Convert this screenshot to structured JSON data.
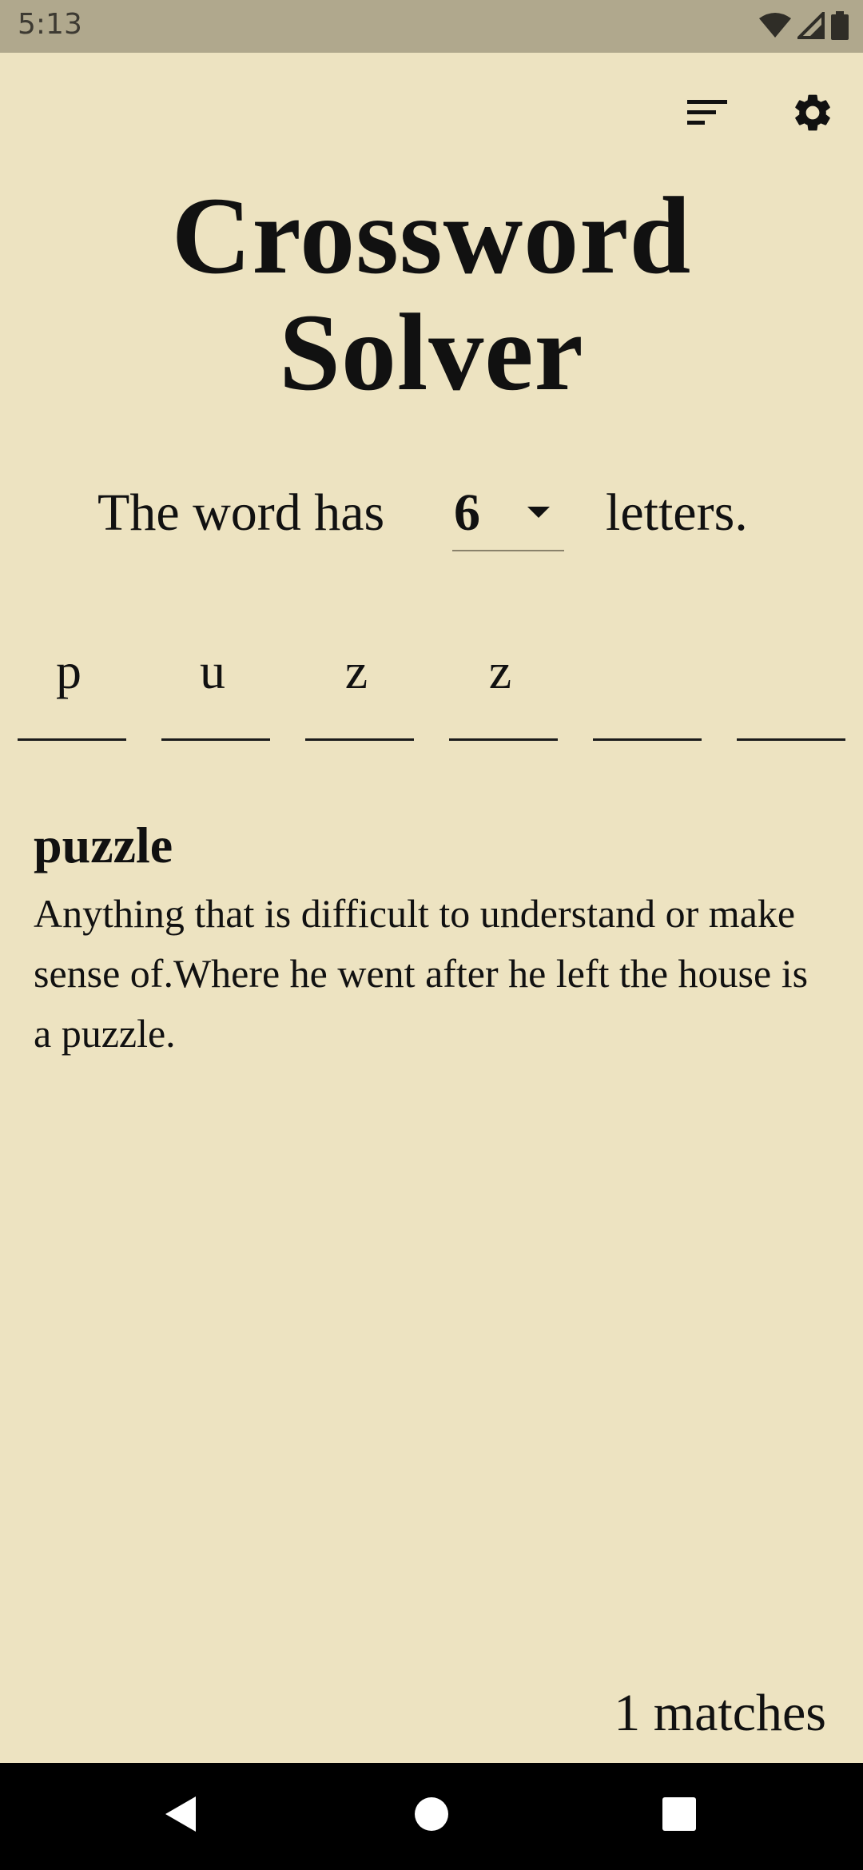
{
  "status_bar": {
    "time": "5:13",
    "icons": [
      "wifi-icon",
      "cellular-signal-icon",
      "battery-icon"
    ]
  },
  "toolbar": {
    "icons": [
      "sort-icon",
      "settings-gear-icon"
    ]
  },
  "title": {
    "line1": "Crossword",
    "line2": "Solver"
  },
  "length_sentence": {
    "prefix": "The word has",
    "selected_length": "6",
    "suffix": "letters."
  },
  "letters": [
    "p",
    "u",
    "z",
    "z",
    "",
    ""
  ],
  "results": [
    {
      "word": "puzzle",
      "definition": "Anything that is difficult to understand or make sense of.Where he went after he left the house is a puzzle."
    }
  ],
  "match_count_text": "1 matches",
  "nav_bar": {
    "buttons": [
      "back-icon",
      "home-icon",
      "recents-icon"
    ]
  },
  "colors": {
    "background": "#ede3c1",
    "status_bar": "#b0a88d",
    "text": "#111111",
    "nav_bar": "#000000"
  }
}
